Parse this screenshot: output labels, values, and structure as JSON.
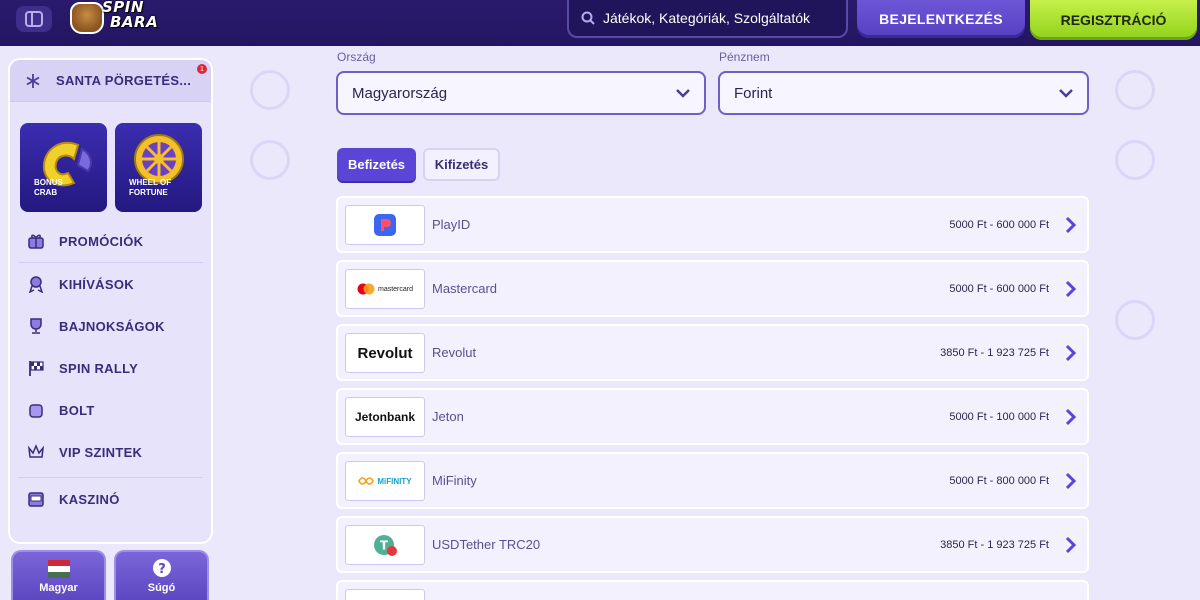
{
  "header": {
    "logo_line1": "SPIN",
    "logo_line2": "BARA",
    "search_placeholder": "Játékok, Kategóriák, Szolgáltatók",
    "login_label": "BEJELENTKEZÉS",
    "register_label": "REGISZTRÁCIÓ"
  },
  "sidebar": {
    "top_item": "SANTA PÖRGETÉS...",
    "top_badge": "1",
    "tiles": [
      {
        "caption_line1": "BONUS",
        "caption_line2": "CRAB"
      },
      {
        "caption_line1": "WHEEL OF",
        "caption_line2": "FORTUNE"
      }
    ],
    "items": [
      {
        "label": "PROMÓCIÓK",
        "icon": "gift-icon"
      },
      {
        "label": "KIHÍVÁSOK",
        "icon": "medal-icon"
      },
      {
        "label": "BAJNOKSÁGOK",
        "icon": "trophy-icon"
      },
      {
        "label": "SPIN RALLY",
        "icon": "checkered-flag-icon"
      },
      {
        "label": "BOLT",
        "icon": "shop-bag-icon"
      },
      {
        "label": "VIP SZINTEK",
        "icon": "crown-icon"
      },
      {
        "label": "KASZINÓ",
        "icon": "slot-machine-icon"
      }
    ],
    "bottom": {
      "language_label": "Magyar",
      "help_label": "Súgó"
    }
  },
  "filters": {
    "country_label": "Ország",
    "country_value": "Magyarország",
    "currency_label": "Pénznem",
    "currency_value": "Forint"
  },
  "tabs": {
    "deposit": "Befizetés",
    "withdraw": "Kifizetés"
  },
  "methods": [
    {
      "name": "PlayID",
      "range": "5000 Ft - 600 000 Ft",
      "logo_text": ""
    },
    {
      "name": "Mastercard",
      "range": "5000 Ft - 600 000 Ft",
      "logo_text": "mastercard"
    },
    {
      "name": "Revolut",
      "range": "3850 Ft - 1 923 725 Ft",
      "logo_text": "Revolut"
    },
    {
      "name": "Jeton",
      "range": "5000 Ft - 100 000 Ft",
      "logo_text": "Jetonbank"
    },
    {
      "name": "MiFinity",
      "range": "5000 Ft - 800 000 Ft",
      "logo_text": "MiFINITY"
    },
    {
      "name": "USDTether TRC20",
      "range": "3850 Ft - 1 923 725 Ft",
      "logo_text": ""
    }
  ],
  "colors": {
    "header_bg": "#231660",
    "accent": "#5b45d6",
    "register_green": "#a6e02c",
    "page_bg": "#ebe8fb"
  }
}
